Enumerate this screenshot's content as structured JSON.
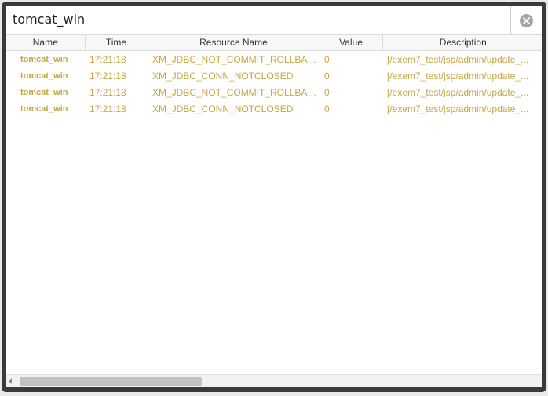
{
  "window": {
    "title": "tomcat_win"
  },
  "grid": {
    "columns": [
      "Name",
      "Time",
      "Resource Name",
      "Value",
      "Description"
    ],
    "rows": [
      {
        "name": "tomcat_win",
        "time": "17:21:18",
        "resource": "XM_JDBC_NOT_COMMIT_ROLLBACK",
        "value": "0",
        "description": "[/exem7_test/jsp/admin/update_..."
      },
      {
        "name": "tomcat_win",
        "time": "17:21:18",
        "resource": "XM_JDBC_CONN_NOTCLOSED",
        "value": "0",
        "description": "[/exem7_test/jsp/admin/update_..."
      },
      {
        "name": "tomcat_win",
        "time": "17:21:18",
        "resource": "XM_JDBC_NOT_COMMIT_ROLLBACK",
        "value": "0",
        "description": "[/exem7_test/jsp/admin/update_..."
      },
      {
        "name": "tomcat_win",
        "time": "17:21:18",
        "resource": "XM_JDBC_CONN_NOTCLOSED",
        "value": "0",
        "description": "[/exem7_test/jsp/admin/update_..."
      }
    ]
  },
  "icons": {
    "close": "close-circle-icon",
    "scroll_left": "chevron-left-icon"
  },
  "colors": {
    "row_text": "#c8a642",
    "frame": "#3a3a3a"
  }
}
